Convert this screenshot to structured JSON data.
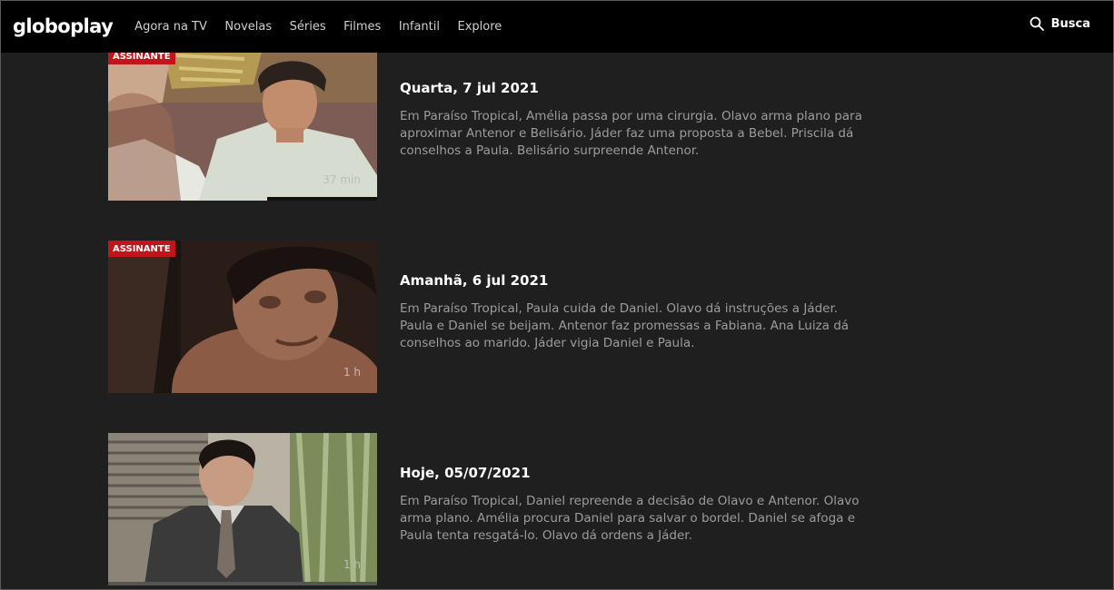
{
  "header": {
    "logo": "globoplay",
    "nav": [
      "Agora na TV",
      "Novelas",
      "Séries",
      "Filmes",
      "Infantil",
      "Explore"
    ],
    "search_label": "Busca"
  },
  "episodes": [
    {
      "badge": "ASSINANTE",
      "duration": "37 min",
      "title": "Quarta, 7 jul 2021",
      "description": "Em Paraíso Tropical, Amélia passa por uma cirurgia. Olavo arma plano para aproximar Antenor e Belisário. Jáder faz uma proposta a Bebel. Priscila dá conselhos a Paula. Belisário surpreende Antenor."
    },
    {
      "badge": "ASSINANTE",
      "duration": "1 h",
      "title": "Amanhã, 6 jul 2021",
      "description": "Em Paraíso Tropical, Paula cuida de Daniel. Olavo dá instruções a Jáder. Paula e Daniel se beijam. Antenor faz promessas a Fabiana. Ana Luiza dá conselhos ao marido. Jáder vigia Daniel e Paula."
    },
    {
      "duration": "1 h",
      "title": "Hoje, 05/07/2021",
      "description": "Em Paraíso Tropical, Daniel repreende a decisão de Olavo e Antenor. Olavo arma plano. Amélia procura Daniel para salvar o bordel. Daniel se afoga e Paula tenta resgatá-lo. Olavo dá ordens a Jáder."
    }
  ]
}
